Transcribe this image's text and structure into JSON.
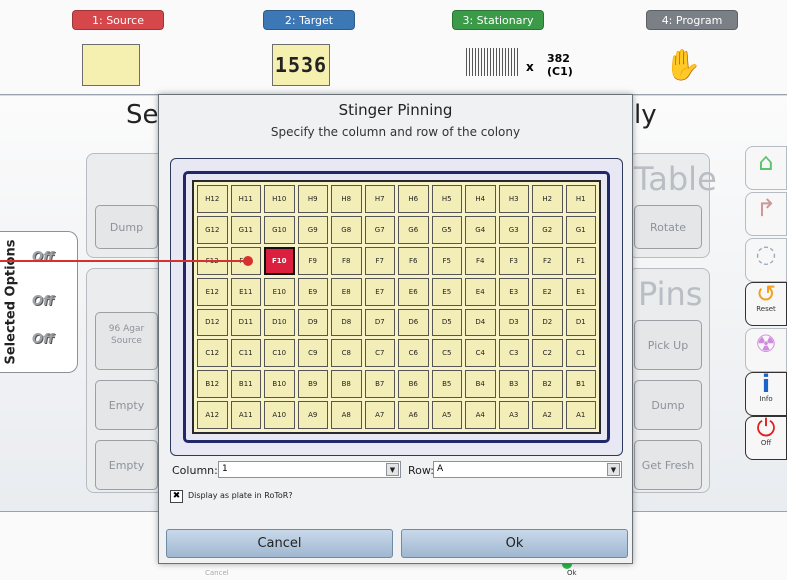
{
  "steps": [
    {
      "label": "1: Source",
      "color": "#d5474a"
    },
    {
      "label": "2: Target",
      "color": "#3d78b6"
    },
    {
      "label": "3: Stationary",
      "color": "#3a9a48"
    },
    {
      "label": "4: Program",
      "color": "#7b7f86"
    }
  ],
  "target_thumb": "1536",
  "stationary": {
    "x": "x",
    "count": "382",
    "well": "(C1)"
  },
  "background": {
    "title_left": "Se",
    "title_right": "ly",
    "left_buttons": {
      "dump": "Dump",
      "agar_source": "96 Agar Source",
      "empty_1": "Empty",
      "empty_2": "Empty"
    },
    "right_headers": {
      "table": "Table",
      "pins": "Pins"
    },
    "right_buttons": {
      "rotate": "Rotate",
      "pick_up": "Pick Up",
      "dump": "Dump",
      "get_fresh": "Get Fresh"
    },
    "cancel": "Cancel",
    "ok": "Ok"
  },
  "side_buttons": {
    "reset": "Reset",
    "info": "Info",
    "off": "Off"
  },
  "selected_options": {
    "label": "Selected Options",
    "off": "Off"
  },
  "dialog": {
    "title": "Stinger Pinning",
    "subtitle": "Specify the column and row of the colony",
    "wells": [
      [
        "H12",
        "H11",
        "H10",
        "H9",
        "H8",
        "H7",
        "H6",
        "H5",
        "H4",
        "H3",
        "H2",
        "H1"
      ],
      [
        "G12",
        "G11",
        "G10",
        "G9",
        "G8",
        "G7",
        "G6",
        "G5",
        "G4",
        "G3",
        "G2",
        "G1"
      ],
      [
        "F12",
        "F11",
        "F10",
        "F9",
        "F8",
        "F7",
        "F6",
        "F5",
        "F4",
        "F3",
        "F2",
        "F1"
      ],
      [
        "E12",
        "E11",
        "E10",
        "E9",
        "E8",
        "E7",
        "E6",
        "E5",
        "E4",
        "E3",
        "E2",
        "E1"
      ],
      [
        "D12",
        "D11",
        "D10",
        "D9",
        "D8",
        "D7",
        "D6",
        "D5",
        "D4",
        "D3",
        "D2",
        "D1"
      ],
      [
        "C12",
        "C11",
        "C10",
        "C9",
        "C8",
        "C7",
        "C6",
        "C5",
        "C4",
        "C3",
        "C2",
        "C1"
      ],
      [
        "B12",
        "B11",
        "B10",
        "B9",
        "B8",
        "B7",
        "B6",
        "B5",
        "B4",
        "B3",
        "B2",
        "B1"
      ],
      [
        "A12",
        "A11",
        "A10",
        "A9",
        "A8",
        "A7",
        "A6",
        "A5",
        "A4",
        "A3",
        "A2",
        "A1"
      ]
    ],
    "selected_well": "F10",
    "selected_color": "#dc1f3e",
    "column_label": "Column:",
    "column_value": "1",
    "row_label": "Row:",
    "row_value": "A",
    "checkbox_mark": "✖",
    "checkbox_label": "Display as plate in RoToR?",
    "cancel_label": "Cancel",
    "ok_label": "Ok"
  }
}
